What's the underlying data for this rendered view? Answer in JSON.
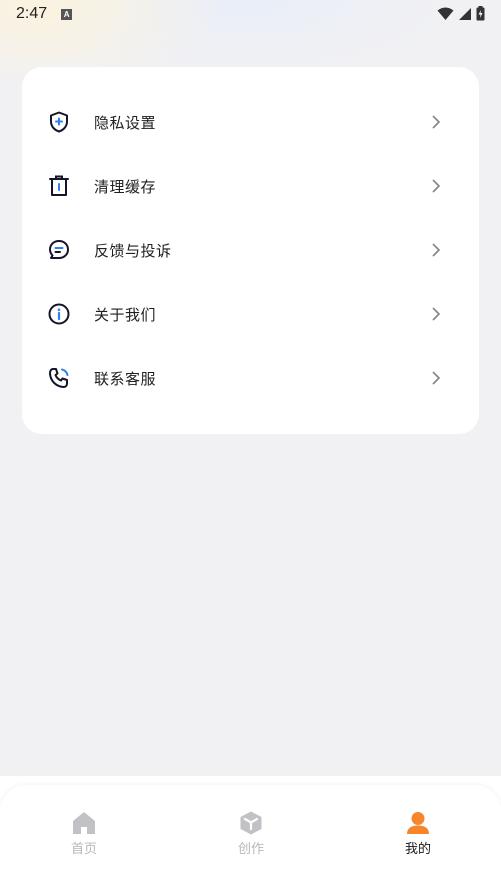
{
  "status_bar": {
    "time": "2:47"
  },
  "menu": {
    "items": [
      {
        "label": "隐私设置",
        "icon": "shield-icon"
      },
      {
        "label": "清理缓存",
        "icon": "trash-icon"
      },
      {
        "label": "反馈与投诉",
        "icon": "chat-bubble-icon"
      },
      {
        "label": "关于我们",
        "icon": "info-icon"
      },
      {
        "label": "联系客服",
        "icon": "phone-icon"
      }
    ]
  },
  "tabbar": {
    "tabs": [
      {
        "label": "首页",
        "icon": "home-icon",
        "active": false
      },
      {
        "label": "创作",
        "icon": "cube-icon",
        "active": false
      },
      {
        "label": "我的",
        "icon": "user-icon",
        "active": true
      }
    ]
  },
  "colors": {
    "accent_orange": "#f5862b",
    "accent_blue": "#2f7ff0",
    "inactive_tab": "#b8b8bc",
    "icon_dark": "#14142b"
  }
}
